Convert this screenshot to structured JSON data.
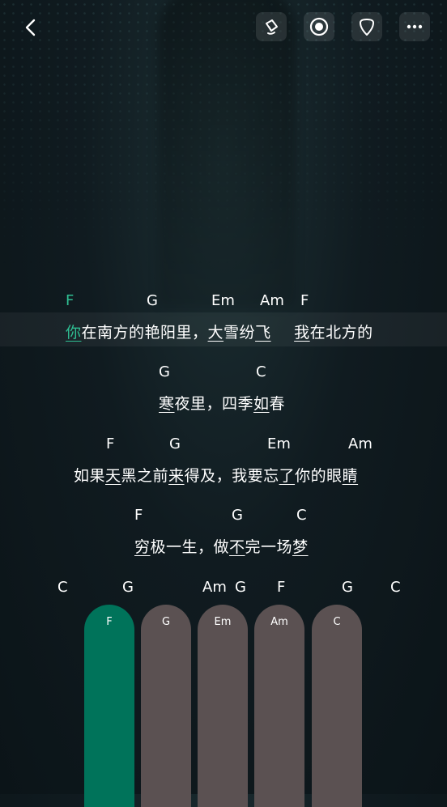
{
  "lines": [
    {
      "chords": [
        {
          "text": "F",
          "active": true
        },
        {
          "text": "G"
        },
        {
          "text": "Em"
        },
        {
          "text": "Am"
        },
        {
          "text": "F"
        }
      ],
      "lyric_parts": [
        "你",
        "在南方的艳阳里，",
        "大",
        "雪纷",
        "飞",
        "我",
        "在北方的"
      ]
    },
    {
      "chords": [
        {
          "text": "G"
        },
        {
          "text": "C"
        }
      ],
      "lyric_parts": [
        "寒",
        "夜里，四季",
        "如",
        "春"
      ]
    },
    {
      "chords": [
        {
          "text": "F"
        },
        {
          "text": "G"
        },
        {
          "text": "Em"
        },
        {
          "text": "Am"
        }
      ],
      "lyric_parts": [
        "如果",
        "天",
        "黑之前",
        "来",
        "得及，我要忘",
        "了",
        "你的眼",
        "睛"
      ]
    },
    {
      "chords": [
        {
          "text": "F"
        },
        {
          "text": "G"
        },
        {
          "text": "C"
        }
      ],
      "lyric_parts": [
        "穷",
        "极一生，做",
        "不",
        "完一场",
        "梦"
      ]
    },
    {
      "chords": [
        {
          "text": "C"
        },
        {
          "text": "G"
        },
        {
          "text": "Am"
        },
        {
          "text": "G"
        },
        {
          "text": "F"
        },
        {
          "text": "G"
        },
        {
          "text": "C"
        }
      ]
    }
  ],
  "pads": [
    {
      "label": "F",
      "active": true
    },
    {
      "label": "G"
    },
    {
      "label": "Em"
    },
    {
      "label": "Am"
    },
    {
      "label": "C"
    }
  ],
  "colors": {
    "accent": "#2fbf93",
    "pad_active": "#00735a",
    "pad": "#5b5152"
  },
  "icons": [
    "back-chevron-icon",
    "eraser-icon",
    "record-icon",
    "pick-icon",
    "more-icon"
  ]
}
